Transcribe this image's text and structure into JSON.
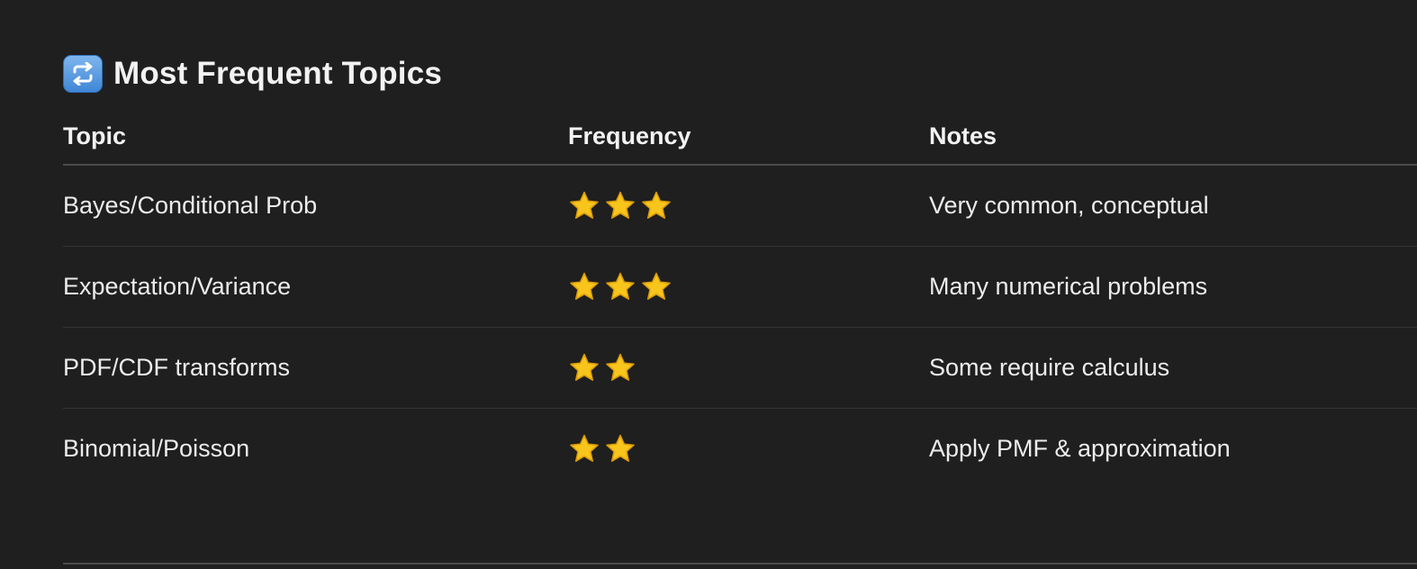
{
  "heading": {
    "icon": "repeat-icon",
    "title": "Most Frequent Topics"
  },
  "table": {
    "headers": {
      "topic": "Topic",
      "frequency": "Frequency",
      "notes": "Notes"
    },
    "rows": [
      {
        "topic": "Bayes/Conditional Prob",
        "stars": 3,
        "notes": "Very common, conceptual"
      },
      {
        "topic": "Expectation/Variance",
        "stars": 3,
        "notes": "Many numerical problems"
      },
      {
        "topic": "PDF/CDF transforms",
        "stars": 2,
        "notes": "Some require calculus"
      },
      {
        "topic": "Binomial/Poisson",
        "stars": 2,
        "notes": "Apply PMF & approximation"
      }
    ]
  },
  "colors": {
    "star_fill": "#f7c51c",
    "icon_accent": "#3f86d6"
  }
}
